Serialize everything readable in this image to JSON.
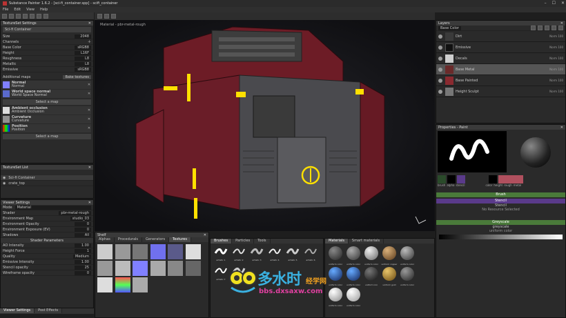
{
  "window": {
    "title": "Substance Painter 1.6.2 - [sci-fi_container.spp] - scifi_container",
    "min": "–",
    "max": "☐",
    "close": "✕"
  },
  "menu": [
    "File",
    "Edit",
    "View",
    "Help"
  ],
  "viewport": {
    "label": "Material - pbr-metal-rough"
  },
  "texture_set_settings": {
    "title": "TextureSet Settings",
    "textureset": "Sci-fi Container",
    "params": [
      {
        "label": "Size",
        "value": "2048"
      },
      {
        "label": "Channels",
        "value": ""
      },
      {
        "label": "Base Color",
        "value": "sRGB8"
      },
      {
        "label": "Height",
        "value": "L16F"
      },
      {
        "label": "Roughness",
        "value": "L8"
      },
      {
        "label": "Metallic",
        "value": "L8"
      },
      {
        "label": "Emissive",
        "value": "sRGB8"
      }
    ],
    "additional_maps_label": "Additional maps",
    "bake_button": "Bake textures",
    "maps": [
      {
        "name": "Normal",
        "file": "Normal",
        "color": "#8080ff"
      },
      {
        "name": "World space normal",
        "file": "World Space Normal",
        "color": "#5a6acc"
      },
      {
        "name": "Ambient occlusion",
        "file": "Ambient Occlusion",
        "color": "#dcdcdc"
      },
      {
        "name": "Curvature",
        "file": "Curvature",
        "color": "#909090"
      },
      {
        "name": "Position",
        "file": "Position",
        "color": "#808080"
      }
    ],
    "select_map": "Select a map"
  },
  "texture_set_list": {
    "title": "TextureSet List",
    "items": [
      "Sci-fi Container",
      "crate_top"
    ]
  },
  "viewer_settings": {
    "title": "Viewer Settings",
    "mode": "Material",
    "rows": [
      {
        "label": "Shader",
        "value": "pbr-metal-rough"
      },
      {
        "label": "Environment Map",
        "value": "studio_03"
      },
      {
        "label": "Environment Opacity",
        "value": "0"
      },
      {
        "label": "Environment Exposure (EV)",
        "value": "0"
      },
      {
        "label": "Shadows",
        "value": "All"
      }
    ],
    "shader_params_title": "Shader Parameters",
    "shader_rows": [
      {
        "label": "AO Intensity",
        "value": "1.00"
      },
      {
        "label": "Height Force",
        "value": "1"
      },
      {
        "label": "Quality",
        "value": "Medium"
      },
      {
        "label": "Emissive Intensity",
        "value": "1.00"
      },
      {
        "label": "Stencil opacity",
        "value": "25"
      },
      {
        "label": "Wireframe opacity",
        "value": "0"
      }
    ]
  },
  "bottom_tabs": [
    "Viewer Settings",
    "Post Effects"
  ],
  "layers": {
    "title": "Layers",
    "blend": "Base Color",
    "items": [
      {
        "name": "Dirt",
        "blend": "Norm 100",
        "color": "#3a3a3a",
        "selected": false
      },
      {
        "name": "Emissive",
        "blend": "Norm 100",
        "color": "#111111",
        "selected": false
      },
      {
        "name": "Decals",
        "blend": "Norm 100",
        "color": "#cfcfcf",
        "selected": false
      },
      {
        "name": "Base Metal",
        "blend": "Norm 100",
        "color": "#6a2a2a",
        "selected": true
      },
      {
        "name": "Base Painted",
        "blend": "Norm 100",
        "color": "#8a2a30",
        "selected": false
      },
      {
        "name": "Height Sculpt",
        "blend": "Norm 100",
        "color": "#777777",
        "selected": false
      }
    ]
  },
  "properties": {
    "title": "Properties - Paint",
    "brush_label": "Brush",
    "stencil_label": "Stencil",
    "stencil_value": "Stencil",
    "stencil_note": "No Resource Selected",
    "greyscale_label": "Greyscale",
    "greyscale_value": "greyscale",
    "greyscale_sub": "uniform color",
    "brush_thumbs": [
      "brush",
      "alpha",
      "stencil"
    ],
    "material_thumbs": [
      "color",
      "height",
      "rough",
      "metal"
    ]
  },
  "shelf": {
    "title": "Shelf",
    "categories": [
      "Alphas",
      "Procedurals",
      "Generators",
      "Textures"
    ],
    "texture_labels": [
      "ambient occlusion",
      "bake",
      "normal",
      "height",
      "scratches",
      "rust",
      "panel",
      "dirt",
      "decal",
      "grunge"
    ],
    "brushes_tabs": [
      "Brushes",
      "Particles",
      "Tools"
    ],
    "brush_labels": [
      "artistic 1",
      "artistic 2",
      "artistic 3",
      "artistic 4",
      "artistic 5",
      "artistic 6",
      "artistic 7",
      "artistic 8"
    ],
    "materials_tabs": [
      "Materials",
      "Smart materials"
    ],
    "material_labels": [
      "uniform color",
      "uniform color",
      "uniform color",
      "uniform copper",
      "uniform color",
      "uniform color",
      "uniform color",
      "uniform iron",
      "uniform gold",
      "uniform color",
      "uniform color",
      "uniform color"
    ]
  },
  "watermark": {
    "main": "多水时",
    "sub": "bbs.dxsaxw.com",
    "tag": "经学网"
  },
  "colors": {
    "accent_purple": "#5a3a8a",
    "accent_green": "#4a7a3a",
    "emissive": "#ffe000",
    "container_red": "#7a1e2a"
  }
}
